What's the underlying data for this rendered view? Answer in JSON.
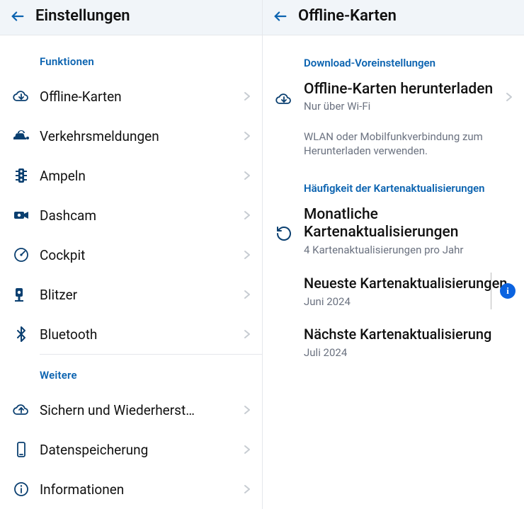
{
  "left": {
    "title": "Einstellungen",
    "sections": [
      {
        "label": "Funktionen",
        "items": [
          {
            "icon": "cloud-download",
            "label": "Offline-Karten"
          },
          {
            "icon": "car",
            "label": "Verkehrsmeldungen"
          },
          {
            "icon": "traffic-light",
            "label": "Ampeln"
          },
          {
            "icon": "dashcam",
            "label": "Dashcam"
          },
          {
            "icon": "gauge",
            "label": "Cockpit"
          },
          {
            "icon": "speed-camera",
            "label": "Blitzer"
          },
          {
            "icon": "bluetooth",
            "label": "Bluetooth"
          }
        ]
      },
      {
        "label": "Weitere",
        "items": [
          {
            "icon": "cloud-up",
            "label": "Sichern und Wiederherst…"
          },
          {
            "icon": "phone",
            "label": "Datenspeicherung"
          },
          {
            "icon": "info-ring",
            "label": "Informationen"
          }
        ]
      }
    ]
  },
  "right": {
    "title": "Offline-Karten",
    "download_section": "Download-Voreinstellungen",
    "download_row": {
      "title": "Offline-Karten herunterladen",
      "sub": "Nur über Wi-Fi"
    },
    "download_note": "WLAN oder Mobilfunkverbindung zum Herunterladen verwenden.",
    "freq_section": "Häufigkeit der Kartenaktualisierungen",
    "freq_row": {
      "title": "Monatliche Kartenaktualisierungen",
      "sub": "4 Kartenaktualisierungen pro Jahr"
    },
    "latest": {
      "title": "Neueste Kartenaktualisierungen",
      "sub": "Juni 2024"
    },
    "next": {
      "title": "Nächste Kartenaktualisierung",
      "sub": "Juli 2024"
    }
  }
}
